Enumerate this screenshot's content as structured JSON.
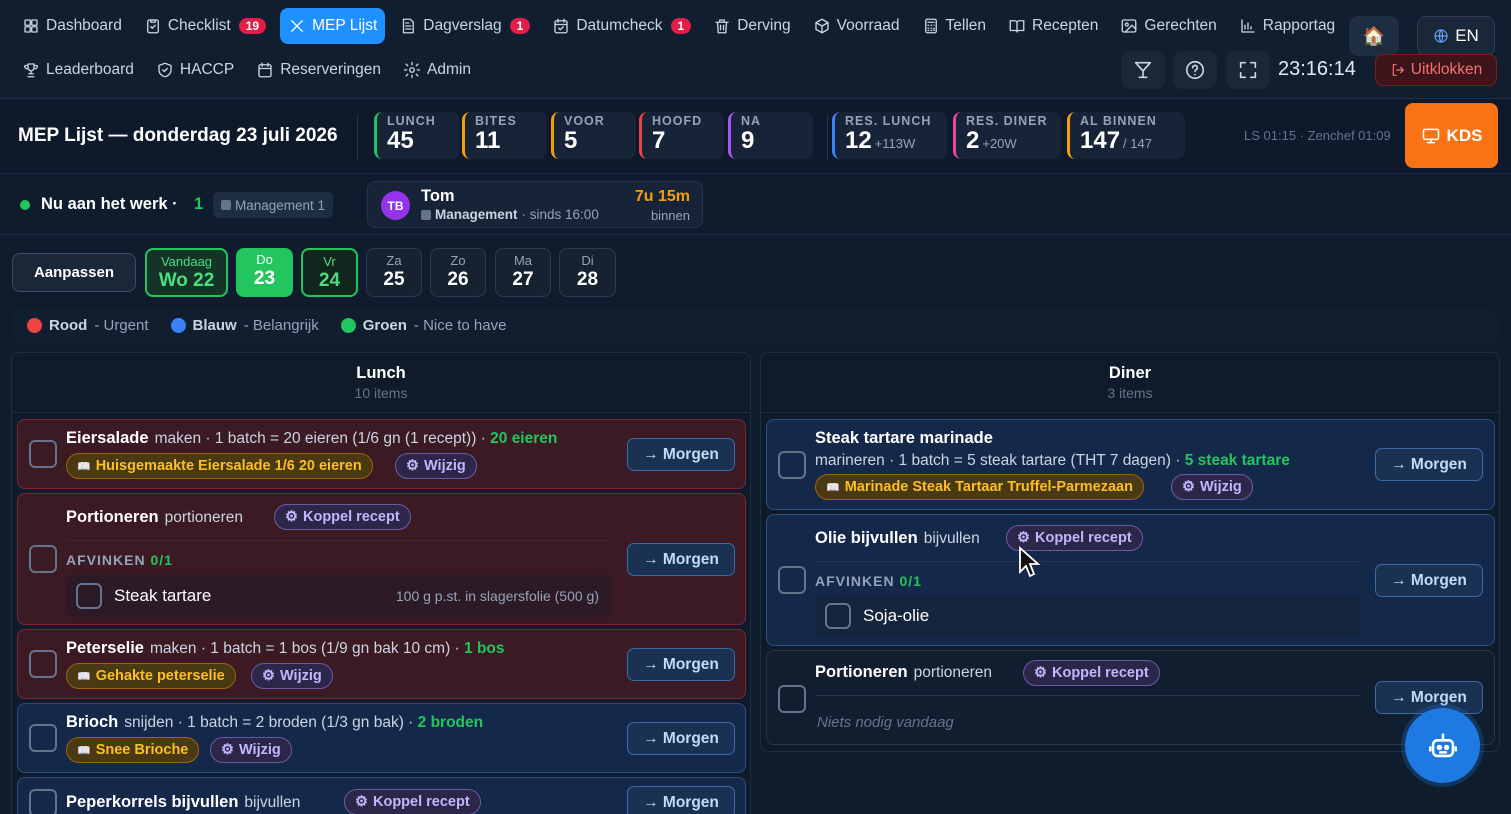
{
  "nav": {
    "row1": [
      {
        "label": "Dashboard",
        "icon": "dashboard-icon"
      },
      {
        "label": "Checklist",
        "icon": "clipboard-icon",
        "badge": "19"
      },
      {
        "label": "MEP Lijst",
        "icon": "utensils-icon",
        "active": true
      },
      {
        "label": "Dagverslag",
        "icon": "document-icon",
        "badge": "1"
      },
      {
        "label": "Datumcheck",
        "icon": "calendar-check-icon",
        "badge": "1"
      },
      {
        "label": "Derving",
        "icon": "trash-icon"
      },
      {
        "label": "Voorraad",
        "icon": "box-icon"
      },
      {
        "label": "Tellen",
        "icon": "calculator-icon"
      },
      {
        "label": "Recepten",
        "icon": "book-icon"
      },
      {
        "label": "Gerechten",
        "icon": "image-icon"
      },
      {
        "label": "Rapportag",
        "icon": "bar-chart-icon"
      }
    ],
    "row2": [
      {
        "label": "Leaderboard",
        "icon": "trophy-icon"
      },
      {
        "label": "HACCP",
        "icon": "shield-icon"
      },
      {
        "label": "Reserveringen",
        "icon": "calendar-icon"
      },
      {
        "label": "Admin",
        "icon": "gear-icon"
      }
    ],
    "home_icon": "🏠",
    "lang": "EN",
    "clock": "23:16:14",
    "clock_out": "Uitklokken"
  },
  "stats": {
    "title": "MEP Lijst — donderdag 23 juli 2026",
    "items": [
      {
        "label": "LUNCH",
        "value": "45",
        "color": "#22c55e"
      },
      {
        "label": "BITES",
        "value": "11",
        "color": "#f59e0b"
      },
      {
        "label": "VOOR",
        "value": "5",
        "color": "#f59e0b"
      },
      {
        "label": "HOOFD",
        "value": "7",
        "color": "#ef4444"
      },
      {
        "label": "NA",
        "value": "9",
        "color": "#a855f7"
      },
      {
        "label": "RES. LUNCH",
        "value": "12",
        "sub": "+113W",
        "color": "#3b82f6"
      },
      {
        "label": "RES. DINER",
        "value": "2",
        "sub": "+20W",
        "color": "#ec4899"
      },
      {
        "label": "AL BINNEN",
        "value": "147",
        "sub": "/ 147",
        "color": "#f59e0b"
      }
    ],
    "info": "LS 01:15 · Zenchef 01:09",
    "kds": "KDS"
  },
  "working": {
    "label": "Nu aan het werk ·",
    "count": "1",
    "badge": "Management 1",
    "employee": {
      "initials": "TB",
      "name": "Tom",
      "role": "Management",
      "since": "· sinds 16:00",
      "duration": "7u 15m",
      "status": "binnen"
    }
  },
  "days": {
    "adjust": "Aanpassen",
    "items": [
      {
        "label": "Vandaag",
        "num": "Wo 22",
        "state": "today"
      },
      {
        "label": "Do",
        "num": "23",
        "state": "sel"
      },
      {
        "label": "Vr",
        "num": "24",
        "state": "next"
      },
      {
        "label": "Za",
        "num": "25",
        "state": ""
      },
      {
        "label": "Zo",
        "num": "26",
        "state": ""
      },
      {
        "label": "Ma",
        "num": "27",
        "state": ""
      },
      {
        "label": "Di",
        "num": "28",
        "state": ""
      }
    ]
  },
  "legend": [
    {
      "name": "Rood",
      "desc": "- Urgent",
      "color": "#ef4444"
    },
    {
      "name": "Blauw",
      "desc": "- Belangrijk",
      "color": "#3b82f6"
    },
    {
      "name": "Groen",
      "desc": "- Nice to have",
      "color": "#22c55e"
    }
  ],
  "lunch": {
    "title": "Lunch",
    "count": "10 items",
    "cards": {
      "eiersalade": {
        "name": "Eiersalade",
        "desc": "maken · 1 batch = 20 eieren (1/6 gn (1 recept)) · ",
        "qty": "20 eieren",
        "recipe": "Huisgemaakte Eiersalade 1/6 20 eieren",
        "edit": "Wijzig",
        "morgen": "→ Morgen"
      },
      "portioneren": {
        "name": "Portioneren",
        "desc": "portioneren",
        "link": "Koppel recept",
        "afvinken": "AFVINKEN",
        "progress": "0/1",
        "sub_name": "Steak tartare",
        "sub_detail": "100 g p.st. in slagersfolie (500 g)",
        "morgen": "→ Morgen"
      },
      "peterselie": {
        "name": "Peterselie",
        "desc": "maken · 1 batch = 1 bos (1/9 gn bak 10 cm) · ",
        "qty": "1 bos",
        "recipe": "Gehakte peterselie",
        "edit": "Wijzig",
        "morgen": "→ Morgen"
      },
      "brioch": {
        "name": "Brioch",
        "desc": "snijden · 1 batch = 2 broden (1/3 gn bak) · ",
        "qty": "2 broden",
        "recipe": "Snee Brioche",
        "edit": "Wijzig",
        "morgen": "→ Morgen"
      },
      "peperkorrels": {
        "name": "Peperkorrels bijvullen",
        "desc": "bijvullen",
        "link": "Koppel recept",
        "morgen": "→ Morgen"
      }
    }
  },
  "diner": {
    "title": "Diner",
    "count": "3 items",
    "cards": {
      "tartare": {
        "name": "Steak tartare marinade",
        "desc": "marineren · 1 batch = 5 steak tartare (THT 7 dagen) · ",
        "qty": "5 steak tartare",
        "recipe": "Marinade Steak Tartaar Truffel-Parmezaan",
        "edit": "Wijzig",
        "morgen": "→ Morgen"
      },
      "olie": {
        "name": "Olie bijvullen",
        "desc": "bijvullen",
        "link": "Koppel recept",
        "afvinken": "AFVINKEN",
        "progress": "0/1",
        "sub_name": "Soja-olie",
        "morgen": "→ Morgen"
      },
      "portioneren": {
        "name": "Portioneren",
        "desc": "portioneren",
        "link": "Koppel recept",
        "empty": "Niets nodig vandaag",
        "morgen": "→ Morgen"
      }
    }
  }
}
